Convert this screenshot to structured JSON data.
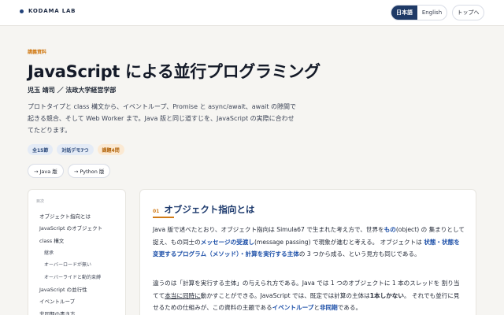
{
  "header": {
    "brand": "KODAMA LAB",
    "lang_ja": "日本語",
    "lang_en": "English",
    "top_button": "トップへ"
  },
  "hero": {
    "kicker": "講義資料",
    "title": "JavaScript による並行プログラミング",
    "author": "児玉 靖司 ／ 法政大学経営学部",
    "lead": "プロトタイプと class 構文から、イベントループ、Promise と async/await、await の隙間で起きる競合、そして Web Worker まで。Java 版と同じ道すじを、JavaScript の実際に合わせてたどります。",
    "tags": [
      "全15節",
      "対話デモ7つ",
      "課題4問"
    ],
    "alt_java": "→ Java 版",
    "alt_python": "→ Python 版"
  },
  "toc": {
    "title": "目次",
    "items": [
      "オブジェクト指向とは",
      "JavaScript のオブジェクト",
      "class 構文",
      "継承",
      "オーバーロードが無い",
      "オーバーライドと動的束縛",
      "JavaScript の並行性",
      "イベントループ",
      "非同期の書き方"
    ]
  },
  "section": {
    "num": "01",
    "title": "オブジェクト指向とは",
    "p1": {
      "a": "Java 版で述べたとおり、オブジェクト指向は Simula67 で生まれた考え方で、世界を",
      "b": "もの",
      "c": "(object) の 集まりとして捉え、もの同士の",
      "d": "メッセージの受渡し",
      "e": "(message passing) で現象が進むと考える。 オブジェクトは ",
      "f": "状態・状態を変更するプログラム（メソッド）・計算を実行する主体",
      "g": "の 3 つから成る、という見方も同じである。"
    },
    "p2": {
      "a": "違うのは「計算を実行する主体」の与えられ方である。Java では 1 つのオブジェクトに 1 本のスレッドを 割り当てて",
      "b": "本当に同時に",
      "c": "動かすことができる。JavaScript では、既定では計算の主体は",
      "d": "1本しかない",
      "e": "。 それでも並行に見せるための仕組みが、この資料の主題である",
      "f": "イベントループ",
      "g": "と",
      "h": "非同期",
      "i": "である。"
    }
  },
  "colors": {
    "accent_orange": "#d17b17",
    "brand_navy": "#1f3a67",
    "highlight_blue": "#1c4fa8"
  }
}
